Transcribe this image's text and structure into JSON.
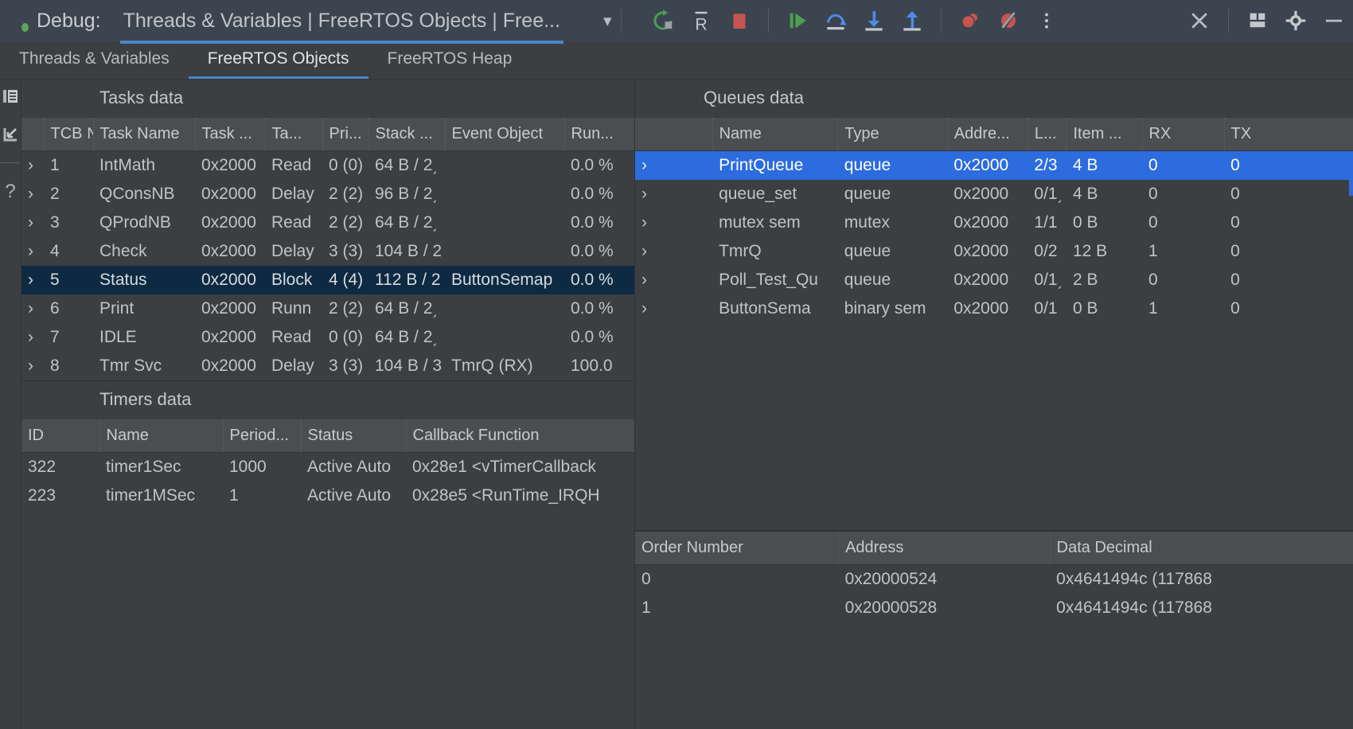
{
  "header": {
    "debug_label": "Debug:",
    "session_title": "Threads & Variables | FreeRTOS Objects | Free...",
    "dropdown_icon": "chevron-down-icon",
    "toolbar": [
      {
        "name": "rerun-icon",
        "label": "Rerun"
      },
      {
        "name": "restart-r-icon",
        "label": "R"
      },
      {
        "name": "stop-icon",
        "label": "Stop"
      },
      {
        "name": "resume-program-icon",
        "label": "Resume Program"
      },
      {
        "name": "step-over-icon",
        "label": "Step Over"
      },
      {
        "name": "step-into-icon",
        "label": "Step Into"
      },
      {
        "name": "step-out-icon",
        "label": "Step Out"
      },
      {
        "name": "view-breakpoints-icon",
        "label": "View Breakpoints"
      },
      {
        "name": "mute-breakpoints-icon",
        "label": "Mute Breakpoints"
      },
      {
        "name": "more-options-icon",
        "label": "More"
      },
      {
        "name": "close-icon",
        "label": "Close"
      },
      {
        "name": "layout-settings-icon",
        "label": "Layout"
      },
      {
        "name": "settings-gear-icon",
        "label": "Settings"
      },
      {
        "name": "minimize-icon",
        "label": "Minimize"
      }
    ]
  },
  "tabs": [
    {
      "label": "Threads & Variables",
      "active": false
    },
    {
      "label": "FreeRTOS Objects",
      "active": true
    },
    {
      "label": "FreeRTOS Heap",
      "active": false
    }
  ],
  "rail": [
    {
      "name": "frames-icon"
    },
    {
      "name": "arrow-down-left-icon"
    },
    {
      "name": "help-question-icon"
    }
  ],
  "tasks": {
    "title": "Tasks data",
    "columns": [
      "",
      "TCB №",
      "Task Name",
      "Task ...",
      "Ta...",
      "Pri...",
      "Stack ...",
      "Event Object",
      "Run..."
    ],
    "rows": [
      {
        "tcb": "1",
        "name": "IntMath",
        "handle": "0x2000",
        "state": "Read",
        "prio": "0 (0)",
        "stack": "64 B / 2͵",
        "event": "",
        "run": "0.0 %",
        "selected": false
      },
      {
        "tcb": "2",
        "name": "QConsNB",
        "handle": "0x2000",
        "state": "Delay",
        "prio": "2 (2)",
        "stack": "96 B / 2͵",
        "event": "",
        "run": "0.0 %",
        "selected": false
      },
      {
        "tcb": "3",
        "name": "QProdNB",
        "handle": "0x2000",
        "state": "Read",
        "prio": "2 (2)",
        "stack": "64 B / 2͵",
        "event": "",
        "run": "0.0 %",
        "selected": false
      },
      {
        "tcb": "4",
        "name": "Check",
        "handle": "0x2000",
        "state": "Delay",
        "prio": "3 (3)",
        "stack": "104 B / 2",
        "event": "",
        "run": "0.0 %",
        "selected": false
      },
      {
        "tcb": "5",
        "name": "Status",
        "handle": "0x2000",
        "state": "Block",
        "prio": "4 (4)",
        "stack": "112 B / 2",
        "event": "ButtonSemap",
        "run": "0.0 %",
        "selected": true
      },
      {
        "tcb": "6",
        "name": "Print",
        "handle": "0x2000",
        "state": "Runn",
        "prio": "2 (2)",
        "stack": "64 B / 2͵",
        "event": "",
        "run": "0.0 %",
        "selected": false
      },
      {
        "tcb": "7",
        "name": "IDLE",
        "handle": "0x2000",
        "state": "Read",
        "prio": "0 (0)",
        "stack": "64 B / 2͵",
        "event": "",
        "run": "0.0 %",
        "selected": false
      },
      {
        "tcb": "8",
        "name": "Tmr Svc",
        "handle": "0x2000",
        "state": "Delay",
        "prio": "3 (3)",
        "stack": "104 B / 3",
        "event": "TmrQ (RX)",
        "run": "100.0",
        "selected": false
      }
    ]
  },
  "timers": {
    "title": "Timers data",
    "columns": [
      "ID",
      "Name",
      "Period...",
      "Status",
      "Callback Function"
    ],
    "rows": [
      {
        "id": "322",
        "name": "timer1Sec",
        "period": "1000",
        "status": "Active Auto",
        "callback": "0x28e1 <vTimerCallback"
      },
      {
        "id": "223",
        "name": "timer1MSec",
        "period": "1",
        "status": "Active Auto",
        "callback": "0x28e5 <RunTime_IRQH"
      }
    ]
  },
  "queues": {
    "title": "Queues data",
    "columns": [
      "",
      "Name",
      "Type",
      "Addre...",
      "L...",
      "Item ...",
      "RX",
      "TX"
    ],
    "rows": [
      {
        "name": "PrintQueue",
        "type": "queue",
        "address": "0x2000",
        "length": "2/3",
        "item": "4 B",
        "rx": "0",
        "tx": "0",
        "selected": true
      },
      {
        "name": "queue_set",
        "type": "queue",
        "address": "0x2000",
        "length": "0/1͵",
        "item": "4 B",
        "rx": "0",
        "tx": "0",
        "selected": false
      },
      {
        "name": "mutex sem",
        "type": "mutex",
        "address": "0x2000",
        "length": "1/1",
        "item": "0 B",
        "rx": "0",
        "tx": "0",
        "selected": false
      },
      {
        "name": "TmrQ",
        "type": "queue",
        "address": "0x2000",
        "length": "0/2",
        "item": "12 B",
        "rx": "1",
        "tx": "0",
        "selected": false
      },
      {
        "name": "Poll_Test_Qu",
        "type": "queue",
        "address": "0x2000",
        "length": "0/1͵",
        "item": "2 B",
        "rx": "0",
        "tx": "0",
        "selected": false
      },
      {
        "name": "ButtonSema",
        "type": "binary sem",
        "address": "0x2000",
        "length": "0/1",
        "item": "0 B",
        "rx": "1",
        "tx": "0",
        "selected": false
      }
    ]
  },
  "queue_detail": {
    "columns": [
      "Order Number",
      "Address",
      "Data Decimal"
    ],
    "rows": [
      {
        "order": "0",
        "address": "0x20000524",
        "data": "0x4641494c (117868"
      },
      {
        "order": "1",
        "address": "0x20000528",
        "data": "0x4641494c (117868"
      }
    ]
  },
  "colors": {
    "accent_blue": "#4a88c7",
    "selection_blue": "#2d6cdf",
    "selection_dark": "#0d2a42",
    "link_blue": "#4c8ce8",
    "background": "#3c3f41",
    "header_bg": "#3c4450",
    "run_green": "#4f9e4f",
    "stop_red": "#c75450"
  }
}
